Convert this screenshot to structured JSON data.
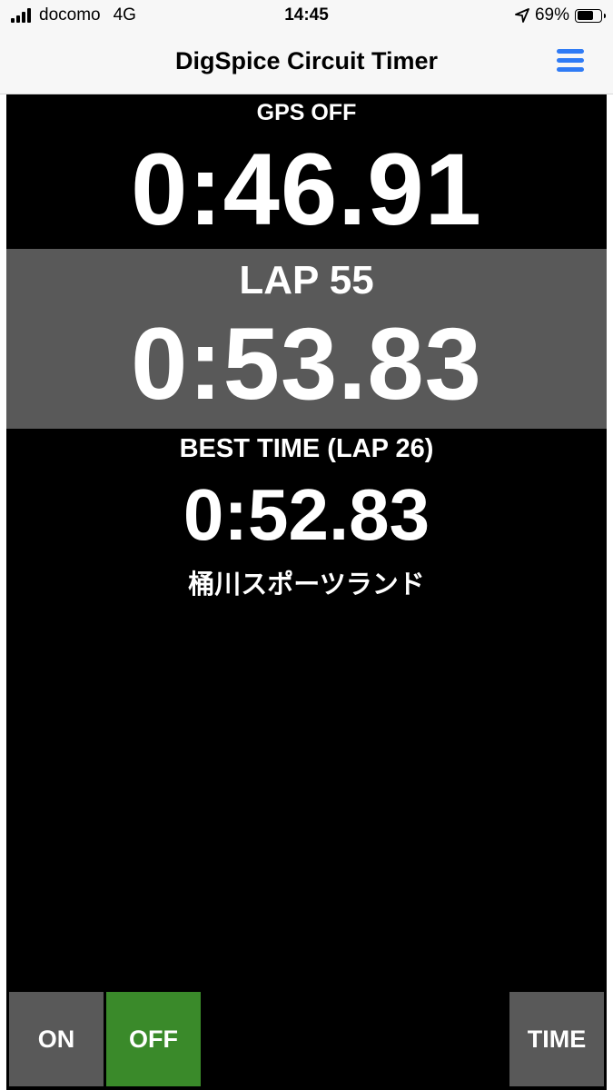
{
  "status_bar": {
    "carrier": "docomo",
    "network": "4G",
    "time": "14:45",
    "battery_percent": "69%",
    "battery_level": 0.69
  },
  "nav": {
    "title": "DigSpice Circuit Timer",
    "menu_icon": "hamburger-menu-icon",
    "accent_color": "#2f7bf5"
  },
  "timer": {
    "gps_status": "GPS OFF",
    "current_time": "0:46.91",
    "lap_label": "LAP 55",
    "lap_time": "0:53.83",
    "best_label": "BEST TIME (LAP 26)",
    "best_time": "0:52.83",
    "circuit_name": "桶川スポーツランド"
  },
  "controls": {
    "on_label": "ON",
    "off_label": "OFF",
    "time_label": "TIME",
    "off_color": "#3a8a2a",
    "neutral_color": "#595959"
  }
}
